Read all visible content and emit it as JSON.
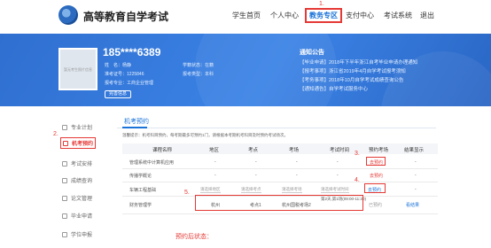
{
  "header": {
    "brand": "高等教育自学考试",
    "nav": [
      "学生首页",
      "个人中心",
      "教务专区",
      "支付中心",
      "考试系统",
      "退出"
    ],
    "active_index": 2
  },
  "profile": {
    "masked_id": "185****6389",
    "avatar_text": "暂无考生照片信息",
    "fields": [
      {
        "label": "姓　名：",
        "value": "杨静"
      },
      {
        "label": "准考证号：",
        "value": "1225846"
      },
      {
        "label": "报考专业：",
        "value": "工商企业管理"
      }
    ],
    "fields_right": [
      {
        "label": "学籍状态：",
        "value": "在籍"
      },
      {
        "label": "报考类型：",
        "value": "本科"
      }
    ],
    "button": "完善信息"
  },
  "notices": {
    "title": "通知公告",
    "items": [
      "【毕业申请】2018年下半年浙江自考毕业申请办理通知",
      "【报考事项】浙江省2019年4月自学考试报考须知",
      "【考务事项】2018年10月自学考试成绩查询公告",
      "【通知通告】自学考试服务中心"
    ]
  },
  "sidebar": [
    {
      "label": "专业计划"
    },
    {
      "label": "机考预约"
    },
    {
      "label": "考试安排"
    },
    {
      "label": "成绩查询"
    },
    {
      "label": "论文管理"
    },
    {
      "label": "毕业申请"
    },
    {
      "label": "学位申报"
    }
  ],
  "sidebar_active": 1,
  "main": {
    "tab": "机考预约",
    "tip": "温馨提示：机考科目预约，每考期最多可预约1门，请根据本考期机考科目及时预约考试场次。",
    "headers": [
      "课程名称",
      "地区",
      "考点",
      "考场",
      "考试时间",
      "预约考场",
      "结果显示"
    ],
    "rows": [
      {
        "course": "管理系统中计算机应用",
        "region": "-",
        "site": "-",
        "room": "-",
        "time": "-",
        "action": "去预约",
        "result": "-"
      },
      {
        "course": "传播学概论",
        "region": "-",
        "site": "-",
        "room": "-",
        "time": "-",
        "action": "去预约",
        "result": "-"
      },
      {
        "course": "车辆工程基础",
        "region": "请选择地区",
        "site": "请选择考点",
        "room": "请选择考场",
        "time": "请选择考试时间",
        "action": "去预约",
        "result": "-"
      },
      {
        "course": "财务管理学",
        "region": "杭州",
        "site": "考点1",
        "room": "杭州国税考场2",
        "time": "第2天,第1场(09:00-11:30)",
        "action": "已预约",
        "result": "看结果"
      }
    ]
  },
  "annotations": {
    "n1": "1.",
    "n2": "2.",
    "n3": "3.",
    "n4": "4.",
    "n5": "5.",
    "after": "预约后状态："
  },
  "colors": {
    "accent": "#1a73d9",
    "annotation": "#e53935",
    "banner": "#3b83e6"
  }
}
